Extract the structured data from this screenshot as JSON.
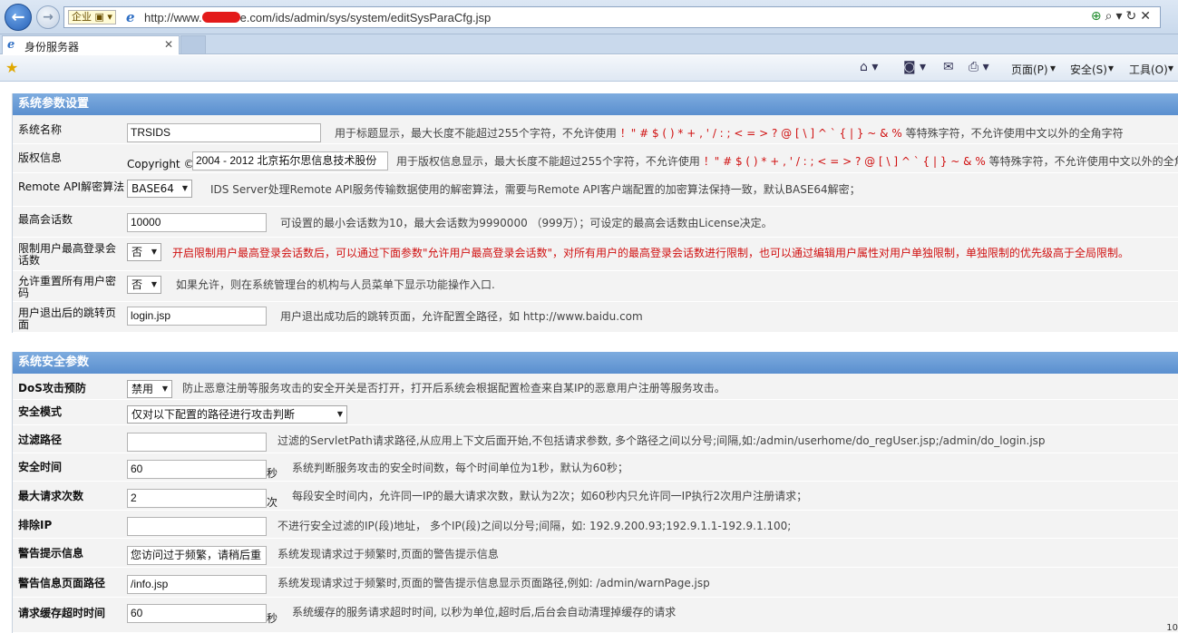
{
  "browser": {
    "compat_label": "企业 ▣ ▾",
    "url_prefix": "http://www.",
    "url_suffix": "e.com/ids/admin/sys/system/editSysParaCfg.jsp",
    "tab_title": "身份服务器",
    "tab_close": "✕",
    "menus": {
      "page": "页面(P)",
      "safety": "安全(S)",
      "tools": "工具(O)"
    },
    "status_text": "10"
  },
  "section1": {
    "title": "系统参数设置",
    "rows": [
      {
        "label": "系统名称",
        "value": "TRSIDS",
        "hint_pre": "用于标题显示，最大长度不能超过255个字符，不允许使用",
        "hint_chars": "！\" # $ ( ) * + , ' / : ; < = > ? @ [ \\ ] ^ ` { | } ~ & %",
        "hint_post": "等特殊字符，不允许使用中文以外的全角字符"
      },
      {
        "label": "版权信息",
        "prefix": "Copyright ©",
        "value": "2004 - 2012 北京拓尔思信息技术股份",
        "hint_pre": "用于版权信息显示，最大长度不能超过255个字符，不允许使用",
        "hint_chars": "！\" # $ ( ) * + , ' / : ; < = > ? @ [ \\ ] ^ ` { | } ~ & %",
        "hint_post": "等特殊字符，不允许使用中文以外的全角字符"
      },
      {
        "label": "Remote API解密算法",
        "value": "BASE64",
        "hint": "IDS Server处理Remote API服务传输数据使用的解密算法，需要与Remote API客户端配置的加密算法保持一致，默认BASE64解密；"
      },
      {
        "label": "最高会话数",
        "value": "10000",
        "hint": "可设置的最小会话数为10，最大会话数为9990000 （999万）；可设定的最高会话数由License决定。"
      },
      {
        "label": "限制用户最高登录会话数",
        "value": "否",
        "hint": "开启限制用户最高登录会话数后，可以通过下面参数\"允许用户最高登录会话数\"，对所有用户的最高登录会话数进行限制，也可以通过编辑用户属性对用户单独限制，单独限制的优先级高于全局限制。"
      },
      {
        "label": "允许重置所有用户密码",
        "value": "否",
        "hint": "如果允许，则在系统管理台的机构与人员菜单下显示功能操作入口."
      },
      {
        "label": "用户退出后的跳转页面",
        "value": "login.jsp",
        "hint": "用户退出成功后的跳转页面，允许配置全路径，如  http://www.baidu.com"
      }
    ]
  },
  "section2": {
    "title": "系统安全参数",
    "rows": [
      {
        "label": "DoS攻击预防",
        "value": "禁用",
        "hint": "防止恶意注册等服务攻击的安全开关是否打开，打开后系统会根据配置检查来自某IP的恶意用户注册等服务攻击。"
      },
      {
        "label": "安全模式",
        "value": "仅对以下配置的路径进行攻击判断",
        "hint": ""
      },
      {
        "label": "过滤路径",
        "value": "",
        "hint": "过滤的ServletPath请求路径,从应用上下文后面开始,不包括请求参数, 多个路径之间以分号;间隔,如:/admin/userhome/do_regUser.jsp;/admin/do_login.jsp"
      },
      {
        "label": "安全时间",
        "value": "60",
        "unit": "秒",
        "hint": "系统判断服务攻击的安全时间数，每个时间单位为1秒，默认为60秒；"
      },
      {
        "label": "最大请求次数",
        "value": "2",
        "unit": "次",
        "hint": "每段安全时间内，允许同一IP的最大请求次数，默认为2次；如60秒内只允许同一IP执行2次用户注册请求；"
      },
      {
        "label": "排除IP",
        "value": "",
        "hint": "不进行安全过滤的IP(段)地址，  多个IP(段)之间以分号;间隔，如: 192.9.200.93;192.9.1.1-192.9.1.100;"
      },
      {
        "label": "警告提示信息",
        "value": "您访问过于频繁，请稍后重",
        "hint": "系统发现请求过于频繁时,页面的警告提示信息"
      },
      {
        "label": "警告信息页面路径",
        "value": "/info.jsp",
        "hint": "系统发现请求过于频繁时,页面的警告提示信息显示页面路径,例如: /admin/warnPage.jsp"
      },
      {
        "label": "请求缓存超时时间",
        "value": "60",
        "unit": "秒",
        "hint": "系统缓存的服务请求超时时间, 以秒为单位,超时后,后台会自动清理掉缓存的请求"
      }
    ]
  }
}
